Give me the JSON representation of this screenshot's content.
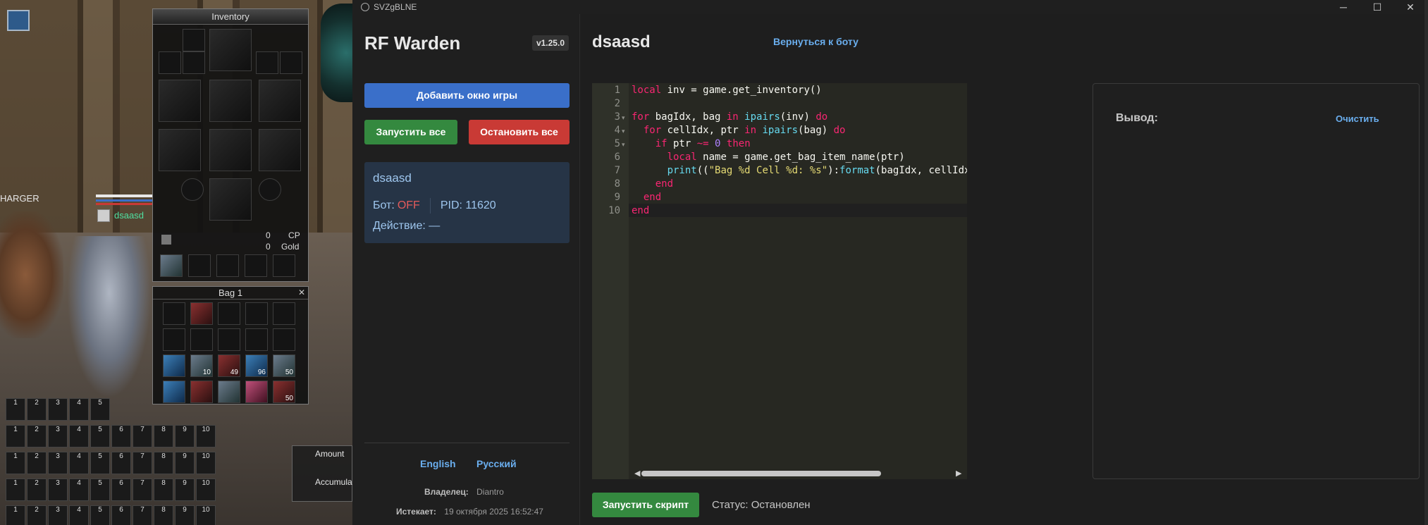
{
  "window": {
    "title": "SVZgBLNE",
    "minimize": "─",
    "maximize": "☐",
    "close": "✕"
  },
  "game": {
    "inventory_title": "Inventory",
    "bag_title": "Bag 1",
    "cp_value": "0",
    "cp_label": "CP",
    "gold_value": "0",
    "gold_label": "Gold",
    "character_name": "dsaasd",
    "left_text": "HARGER",
    "bag_quantities": [
      "10",
      "49",
      "96",
      "50",
      "50"
    ],
    "hotbar_numbers": [
      "1",
      "2",
      "3",
      "4",
      "5",
      "6",
      "7",
      "8",
      "9",
      "10"
    ],
    "amount_label": "Amount",
    "accumul_label": "Accumula"
  },
  "sidebar": {
    "brand": "RF Warden",
    "version": "v1.25.0",
    "add_window": "Добавить окно игры",
    "start_all": "Запустить все",
    "stop_all": "Остановить все",
    "bot": {
      "name": "dsaasd",
      "bot_label": "Бот:",
      "bot_state": "OFF",
      "pid": "PID: 11620",
      "action": "Действие: —"
    },
    "lang_en": "English",
    "lang_ru": "Русский",
    "owner_label": "Владелец:",
    "owner_value": "Diantro",
    "expires_label": "Истекает:",
    "expires_value": "19 октября 2025 16:52:47"
  },
  "main": {
    "title": "dsaasd",
    "back_link": "Вернуться к боту",
    "output_label": "Вывод:",
    "clear": "Очистить",
    "run_script": "Запустить скрипт",
    "status": "Статус: Остановлен"
  },
  "editor": {
    "line_numbers": [
      "1",
      "2",
      "3",
      "4",
      "5",
      "6",
      "7",
      "8",
      "9",
      "10"
    ]
  },
  "colors": {
    "accent_blue": "#3a6fc9",
    "green": "#34893f",
    "red": "#c93a35",
    "link": "#6aaeee"
  }
}
